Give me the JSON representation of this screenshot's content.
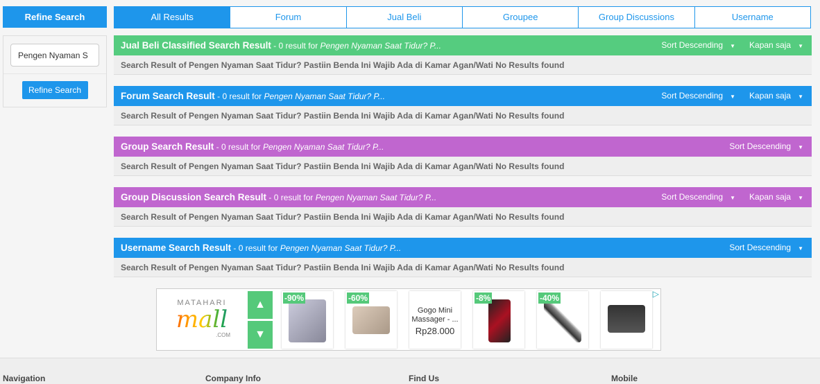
{
  "sidebar": {
    "title": "Refine Search",
    "input_value": "Pengen Nyaman S",
    "button": "Refine Search"
  },
  "tabs": [
    "All Results",
    "Forum",
    "Jual Beli",
    "Groupee",
    "Group Discussions",
    "Username"
  ],
  "active_tab": "All Results",
  "sections": [
    {
      "title": "Jual Beli Classified Search Result",
      "count": " - 0 result for ",
      "query": "Pengen Nyaman Saat Tidur? P...",
      "sort": "Sort Descending",
      "time": "Kapan saja",
      "color": "#55cc7f",
      "message": "Search Result of Pengen Nyaman Saat Tidur? Pastiin Benda Ini Wajib Ada di Kamar Agan/Wati No Results found"
    },
    {
      "title": "Forum Search Result",
      "count": " - 0 result for ",
      "query": "Pengen Nyaman Saat Tidur? P...",
      "sort": "Sort Descending",
      "time": "Kapan saja",
      "color": "#1e96eb",
      "message": "Search Result of Pengen Nyaman Saat Tidur? Pastiin Benda Ini Wajib Ada di Kamar Agan/Wati No Results found"
    },
    {
      "title": "Group Search Result",
      "count": " - 0 result for ",
      "query": "Pengen Nyaman Saat Tidur? P...",
      "sort": "Sort Descending",
      "color": "#c066cf",
      "message": "Search Result of Pengen Nyaman Saat Tidur? Pastiin Benda Ini Wajib Ada di Kamar Agan/Wati No Results found"
    },
    {
      "title": "Group Discussion Search Result",
      "count": " - 0 result for ",
      "query": "Pengen Nyaman Saat Tidur? P...",
      "sort": "Sort Descending",
      "time": "Kapan saja",
      "color": "#c066cf",
      "message": "Search Result of Pengen Nyaman Saat Tidur? Pastiin Benda Ini Wajib Ada di Kamar Agan/Wati No Results found"
    },
    {
      "title": "Username Search Result",
      "count": " - 0 result for ",
      "query": "Pengen Nyaman Saat Tidur? P...",
      "sort": "Sort Descending",
      "color": "#1e96eb",
      "message": "Search Result of Pengen Nyaman Saat Tidur? Pastiin Benda Ini Wajib Ada di Kamar Agan/Wati No Results found"
    }
  ],
  "ad": {
    "logo": "MATAHARI mall .COM",
    "logo_top": "MATAHARI",
    "logo_main": "mall",
    "logo_sub": ".COM",
    "products": [
      {
        "badge": "-90%"
      },
      {
        "badge": "-60%"
      },
      {
        "name": "Gogo Mini Massager - ...",
        "price": "Rp28.000"
      },
      {
        "badge": "-8%"
      },
      {
        "badge": "-40%"
      },
      {}
    ]
  },
  "footer": [
    "Navigation",
    "Company Info",
    "Find Us",
    "Mobile"
  ]
}
